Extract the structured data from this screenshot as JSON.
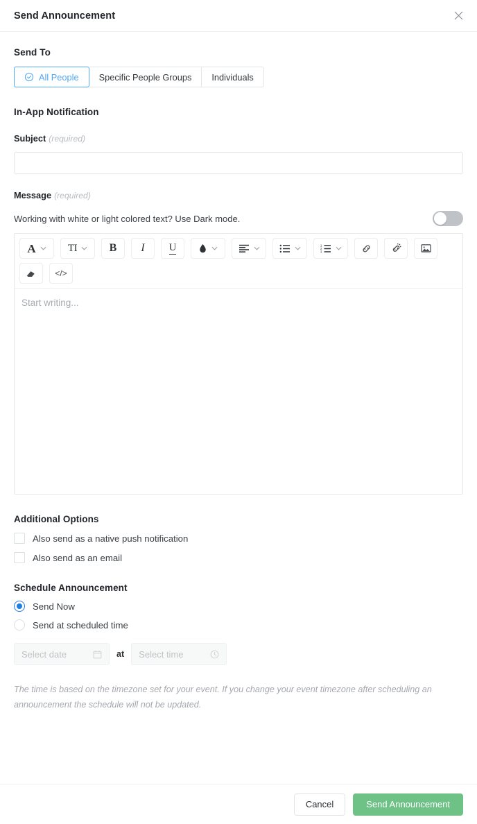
{
  "header": {
    "title": "Send Announcement",
    "close_icon": "close-icon"
  },
  "send_to": {
    "label": "Send To",
    "options": [
      {
        "label": "All People",
        "selected": true,
        "icon": "check-circle-icon"
      },
      {
        "label": "Specific People Groups",
        "selected": false
      },
      {
        "label": "Individuals",
        "selected": false
      }
    ]
  },
  "in_app_notification": {
    "label": "In-App Notification",
    "subject": {
      "label": "Subject",
      "required_note": "(required)",
      "value": "",
      "placeholder": ""
    },
    "message": {
      "label": "Message",
      "required_note": "(required)",
      "dark_mode_text": "Working with white or light colored text? Use Dark mode.",
      "dark_mode_enabled": false,
      "editor_placeholder": "Start writing...",
      "toolbar": [
        {
          "icon": "font-family-icon",
          "glyph": "A",
          "has_dropdown": true
        },
        {
          "icon": "font-size-icon",
          "glyph": "TI",
          "has_dropdown": true
        },
        {
          "icon": "bold-icon",
          "glyph": "B",
          "has_dropdown": false
        },
        {
          "icon": "italic-icon",
          "glyph": "I",
          "has_dropdown": false
        },
        {
          "icon": "underline-icon",
          "glyph": "U",
          "has_dropdown": false
        },
        {
          "icon": "text-color-icon",
          "glyph": "droplet",
          "has_dropdown": true
        },
        {
          "icon": "align-left-icon",
          "glyph": "align",
          "has_dropdown": true
        },
        {
          "icon": "bullet-list-icon",
          "glyph": "bullets",
          "has_dropdown": true
        },
        {
          "icon": "numbered-list-icon",
          "glyph": "numbers",
          "has_dropdown": true
        },
        {
          "icon": "link-icon",
          "glyph": "link",
          "has_dropdown": false
        },
        {
          "icon": "unlink-icon",
          "glyph": "unlink",
          "has_dropdown": false
        },
        {
          "icon": "insert-image-icon",
          "glyph": "image",
          "has_dropdown": false
        },
        {
          "icon": "clear-formatting-icon",
          "glyph": "eraser",
          "has_dropdown": false
        },
        {
          "icon": "code-view-icon",
          "glyph": "code",
          "has_dropdown": false
        }
      ]
    }
  },
  "additional_options": {
    "label": "Additional Options",
    "items": [
      {
        "label": "Also send as a native push notification",
        "checked": false
      },
      {
        "label": "Also send as an email",
        "checked": false
      }
    ]
  },
  "schedule": {
    "label": "Schedule Announcement",
    "options": [
      {
        "label": "Send Now",
        "selected": true
      },
      {
        "label": "Send at scheduled time",
        "selected": false
      }
    ],
    "date_placeholder": "Select date",
    "at_label": "at",
    "time_placeholder": "Select time",
    "date_icon": "calendar-icon",
    "time_icon": "clock-icon",
    "note": "The time is based on the timezone set for your event. If you change your event timezone after scheduling an announcement the schedule will not be updated."
  },
  "footer": {
    "cancel_label": "Cancel",
    "submit_label": "Send Announcement"
  },
  "colors": {
    "accent_blue": "#52a7f7",
    "radio_blue": "#1f7fe0",
    "primary_green": "#6ec286",
    "border": "#e3e6e8",
    "text": "#2c3034",
    "muted": "#a4a8ad"
  }
}
